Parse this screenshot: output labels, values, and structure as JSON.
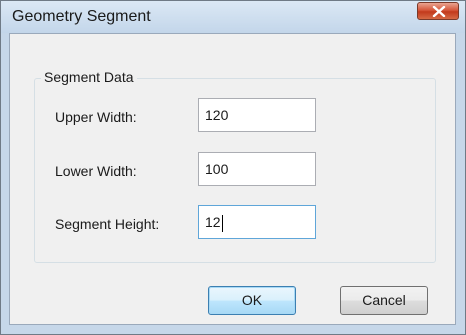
{
  "window": {
    "title": "Geometry Segment",
    "close_icon": "close-icon"
  },
  "group": {
    "legend": "Segment Data"
  },
  "fields": [
    {
      "label": "Upper Width:",
      "value": "120"
    },
    {
      "label": "Lower Width:",
      "value": "100"
    },
    {
      "label": "Segment Height:",
      "value": "12"
    }
  ],
  "buttons": {
    "ok_label": "OK",
    "cancel_label": "Cancel"
  },
  "colors": {
    "titlebar": "#c3d6ea",
    "close_button": "#c23a1c",
    "default_button_border": "#3c7fb1"
  }
}
